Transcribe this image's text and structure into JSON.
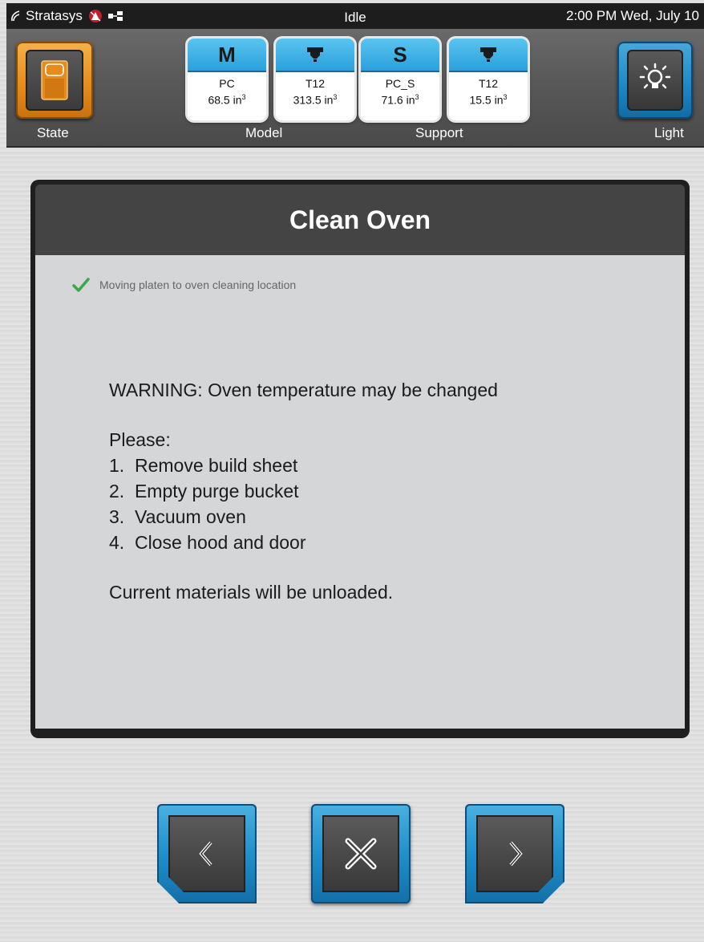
{
  "status_bar": {
    "brand": "Stratasys",
    "state": "Idle",
    "datetime": "2:00 PM Wed, July 10"
  },
  "toolbar": {
    "state_label": "State",
    "model_label": "Model",
    "support_label": "Support",
    "light_label": "Light",
    "materials": [
      {
        "badge": "M",
        "name": "PC",
        "volume": "68.5 in",
        "unit_exp": "3"
      },
      {
        "badge": "tip-icon",
        "name": "T12",
        "volume": "313.5 in",
        "unit_exp": "3"
      },
      {
        "badge": "S",
        "name": "PC_S",
        "volume": "71.6 in",
        "unit_exp": "3"
      },
      {
        "badge": "tip-icon",
        "name": "T12",
        "volume": "15.5 in",
        "unit_exp": "3"
      }
    ]
  },
  "dialog": {
    "title": "Clean Oven",
    "progress_text": "Moving platen to oven cleaning location",
    "warning": "WARNING: Oven temperature may be changed",
    "please": "Please:",
    "steps": [
      "1.  Remove build sheet",
      "2.  Empty purge bucket",
      "3.  Vacuum oven",
      "4.  Close hood and door"
    ],
    "footer": "Current materials will be unloaded."
  },
  "colors": {
    "accent_blue": "#1f8cc8",
    "state_orange": "#e48a1a",
    "check_green": "#3aa84a"
  },
  "nav": {
    "back_icon": "chevron-left-icon",
    "cancel_icon": "close-icon",
    "next_icon": "chevron-right-icon"
  }
}
